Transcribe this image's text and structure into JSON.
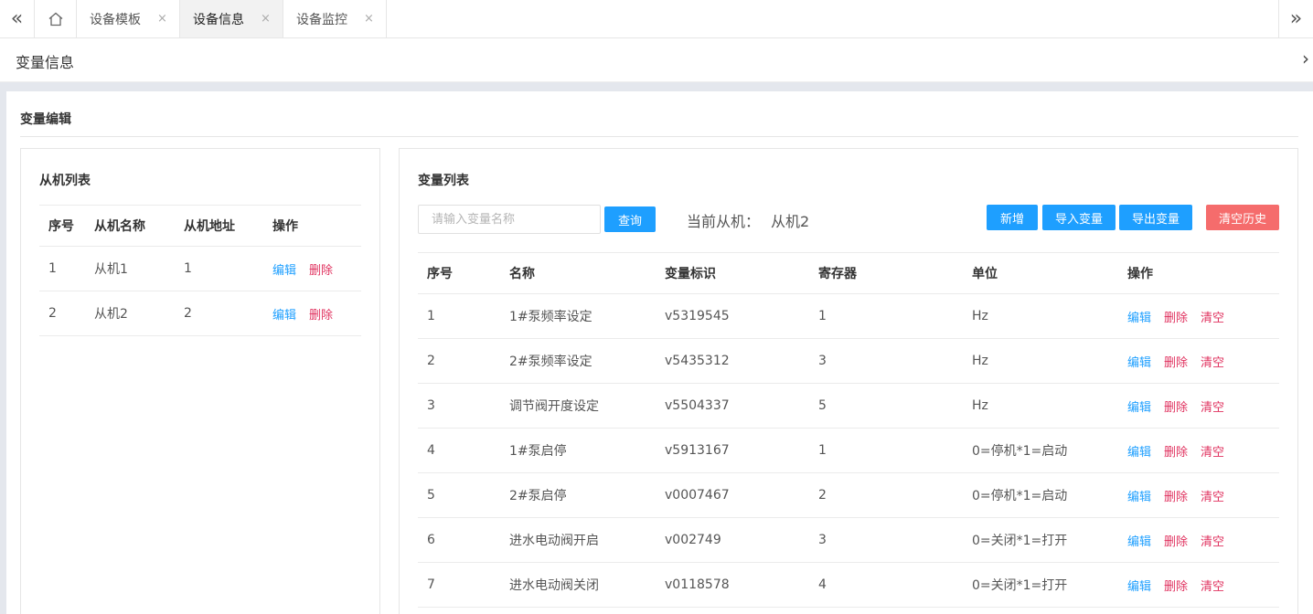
{
  "tabbar": {
    "nav_left": "«",
    "nav_right": "»",
    "home_icon": "home-icon",
    "tabs": [
      {
        "label": "设备模板",
        "close": "×"
      },
      {
        "label": "设备信息",
        "close": "×"
      },
      {
        "label": "设备监控",
        "close": "×"
      }
    ],
    "active_tab": 1
  },
  "page": {
    "title": "变量信息",
    "chevron": "›"
  },
  "card": {
    "title": "变量编辑"
  },
  "slaves": {
    "title": "从机列表",
    "headers": [
      "序号",
      "从机名称",
      "从机地址",
      "操作"
    ],
    "rows": [
      {
        "no": "1",
        "name": "从机1",
        "addr": "1",
        "edit": "编辑",
        "del": "删除"
      },
      {
        "no": "2",
        "name": "从机2",
        "addr": "2",
        "edit": "编辑",
        "del": "删除"
      }
    ]
  },
  "vars": {
    "title": "变量列表",
    "search_placeholder": "请输入变量名称",
    "query_label": "查询",
    "current_label": "当前从机：",
    "current_value": "从机2",
    "add_label": "新增",
    "import_label": "导入变量",
    "export_label": "导出变量",
    "clear_history_label": "清空历史",
    "headers": [
      "序号",
      "名称",
      "变量标识",
      "寄存器",
      "单位",
      "操作"
    ],
    "rows": [
      {
        "no": "1",
        "name": "1#泵频率设定",
        "id": "v5319545",
        "reg": "1",
        "unit": "Hz",
        "edit": "编辑",
        "del": "删除",
        "clear": "清空"
      },
      {
        "no": "2",
        "name": "2#泵频率设定",
        "id": "v5435312",
        "reg": "3",
        "unit": "Hz",
        "edit": "编辑",
        "del": "删除",
        "clear": "清空"
      },
      {
        "no": "3",
        "name": "调节阀开度设定",
        "id": "v5504337",
        "reg": "5",
        "unit": "Hz",
        "edit": "编辑",
        "del": "删除",
        "clear": "清空"
      },
      {
        "no": "4",
        "name": "1#泵启停",
        "id": "v5913167",
        "reg": "1",
        "unit": "0=停机*1=启动",
        "edit": "编辑",
        "del": "删除",
        "clear": "清空"
      },
      {
        "no": "5",
        "name": "2#泵启停",
        "id": "v0007467",
        "reg": "2",
        "unit": "0=停机*1=启动",
        "edit": "编辑",
        "del": "删除",
        "clear": "清空"
      },
      {
        "no": "6",
        "name": "进水电动阀开启",
        "id": "v002749",
        "reg": "3",
        "unit": "0=关闭*1=打开",
        "edit": "编辑",
        "del": "删除",
        "clear": "清空"
      },
      {
        "no": "7",
        "name": "进水电动阀关闭",
        "id": "v0118578",
        "reg": "4",
        "unit": "0=关闭*1=打开",
        "edit": "编辑",
        "del": "删除",
        "clear": "清空"
      }
    ]
  }
}
